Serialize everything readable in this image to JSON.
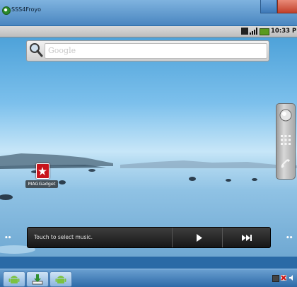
{
  "window": {
    "title": "SSS4Froyo"
  },
  "statusbar": {
    "time": "10:33 PM"
  },
  "search": {
    "placeholder": "Google"
  },
  "home": {
    "app": {
      "label": "MAGGadget"
    },
    "page_indicator_left": "••",
    "page_indicator_right": "••"
  },
  "music": {
    "prompt": "Touch to select music."
  },
  "icons": {
    "search": "magnifier-icon",
    "browser": "globe-icon",
    "apps": "app-grid-icon",
    "phone": "phone-icon",
    "play": "play-icon",
    "next": "next-track-icon",
    "android": "android-icon",
    "download": "download-icon"
  },
  "colors": {
    "accent": "#c8141c",
    "taskbar": "#2d6aa8"
  }
}
